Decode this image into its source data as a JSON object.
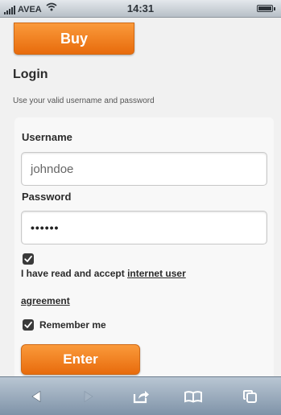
{
  "status_bar": {
    "carrier": "AVEA",
    "time": "14:31"
  },
  "buy_button": {
    "label": "Buy"
  },
  "login": {
    "title": "Login",
    "subtitle": "Use your valid username and password",
    "username": {
      "label": "Username",
      "value": "johndoe"
    },
    "password": {
      "label": "Password",
      "value": "••••••"
    },
    "agreement": {
      "checked": true,
      "text": "I have read and accept ",
      "link_part1": "internet user",
      "link_part2": "agreement"
    },
    "remember": {
      "checked": true,
      "label": "Remember me"
    },
    "enter_button": {
      "label": "Enter"
    }
  },
  "toolbar": {
    "icons": [
      "back-icon",
      "forward-icon",
      "share-icon",
      "bookmarks-icon",
      "pages-icon"
    ]
  },
  "colors": {
    "accent_orange": "#f0821f",
    "toolbar": "#9aabbd"
  }
}
